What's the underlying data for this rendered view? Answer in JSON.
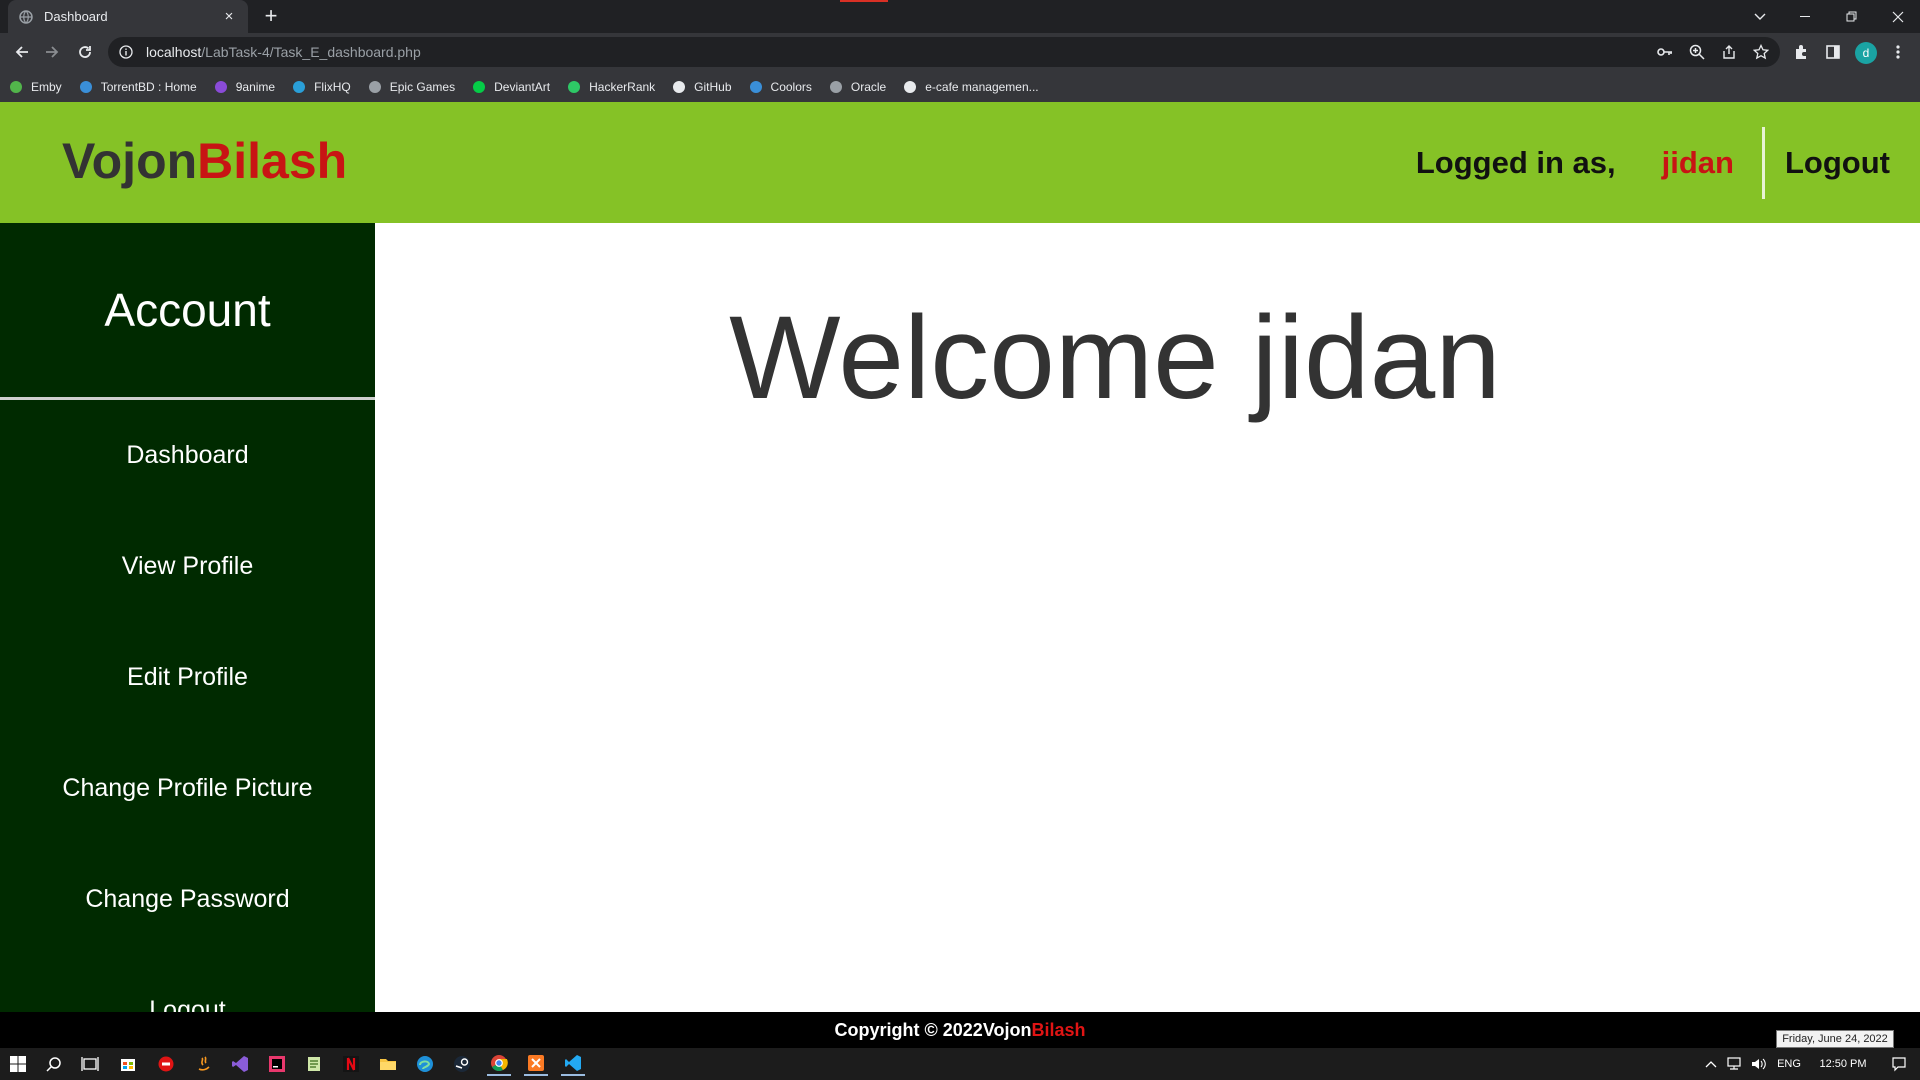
{
  "browser": {
    "tab_title": "Dashboard",
    "tab_close": "×",
    "new_tab": "+",
    "url_host": "localhost",
    "url_path": "/LabTask-4/Task_E_dashboard.php",
    "profile_initial": "d",
    "bookmarks": [
      {
        "label": "Emby",
        "icon": "emby-icon",
        "color": "#52b54b"
      },
      {
        "label": "TorrentBD : Home",
        "icon": "torrentbd-icon",
        "color": "#3a8fd8"
      },
      {
        "label": "9anime",
        "icon": "9anime-icon",
        "color": "#8a4bd8"
      },
      {
        "label": "FlixHQ",
        "icon": "flixhq-icon",
        "color": "#2a9fd8"
      },
      {
        "label": "Epic Games",
        "icon": "epic-games-icon",
        "color": "#9aa0a6"
      },
      {
        "label": "DeviantArt",
        "icon": "deviantart-icon",
        "color": "#05cc47"
      },
      {
        "label": "HackerRank",
        "icon": "hackerrank-icon",
        "color": "#2ec866"
      },
      {
        "label": "GitHub",
        "icon": "github-icon",
        "color": "#e8eaed"
      },
      {
        "label": "Coolors",
        "icon": "coolors-icon",
        "color": "#3a8fd8"
      },
      {
        "label": "Oracle",
        "icon": "oracle-icon",
        "color": "#9aa0a6"
      },
      {
        "label": "e-cafe managemen...",
        "icon": "google-icon",
        "color": "#e8eaed"
      }
    ]
  },
  "header": {
    "logo_part1": "Vojon",
    "logo_part2": "Bilash",
    "logged_in_label": "Logged in as,",
    "username": "jidan",
    "logout": "Logout"
  },
  "sidebar": {
    "title": "Account",
    "items": [
      {
        "label": "Dashboard"
      },
      {
        "label": "View Profile"
      },
      {
        "label": "Edit Profile"
      },
      {
        "label": "Change Profile Picture"
      },
      {
        "label": "Change Password"
      },
      {
        "label": "Logout"
      }
    ]
  },
  "main": {
    "welcome": "Welcome jidan"
  },
  "footer": {
    "copyright": "Copyright © 2022 ",
    "brand1": "Vojon",
    "brand2": "Bilash"
  },
  "taskbar": {
    "language": "ENG",
    "time": "12:50 PM",
    "date_tooltip": "Friday, June 24, 2022"
  },
  "colors": {
    "header_green": "#85c226",
    "sidebar_dark_green": "#002a00",
    "brand_red": "#c81414",
    "footer_black": "#000000"
  }
}
